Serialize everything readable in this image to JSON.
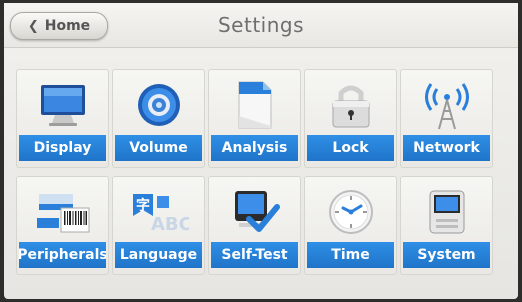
{
  "header": {
    "back_label": "Home",
    "title": "Settings"
  },
  "tiles": [
    {
      "label": "Display",
      "icon": "display-icon"
    },
    {
      "label": "Volume",
      "icon": "speaker-icon"
    },
    {
      "label": "Analysis",
      "icon": "document-icon"
    },
    {
      "label": "Lock",
      "icon": "lock-icon"
    },
    {
      "label": "Network",
      "icon": "antenna-icon"
    },
    {
      "label": "Peripherals",
      "icon": "barcode-printer-icon"
    },
    {
      "label": "Language",
      "icon": "language-abc-icon"
    },
    {
      "label": "Self-Test",
      "icon": "self-test-check-icon"
    },
    {
      "label": "Time",
      "icon": "clock-icon"
    },
    {
      "label": "System",
      "icon": "system-device-icon"
    }
  ],
  "colors": {
    "label_bg": "#2383d6",
    "label_text": "#ffffff",
    "background": "#eceae6"
  }
}
